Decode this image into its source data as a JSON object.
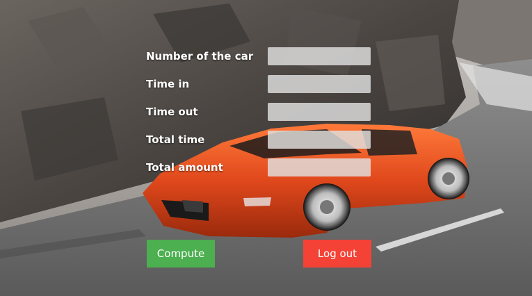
{
  "form": {
    "fields": [
      {
        "label": "Number of the car",
        "value": ""
      },
      {
        "label": "Time in",
        "value": ""
      },
      {
        "label": "Time out",
        "value": ""
      },
      {
        "label": "Total time",
        "value": ""
      },
      {
        "label": "Total amount",
        "value": ""
      }
    ]
  },
  "buttons": {
    "compute": "Compute",
    "logout": "Log out"
  },
  "colors": {
    "compute": "#4caf50",
    "logout": "#f44336",
    "car": "#e0481c"
  }
}
